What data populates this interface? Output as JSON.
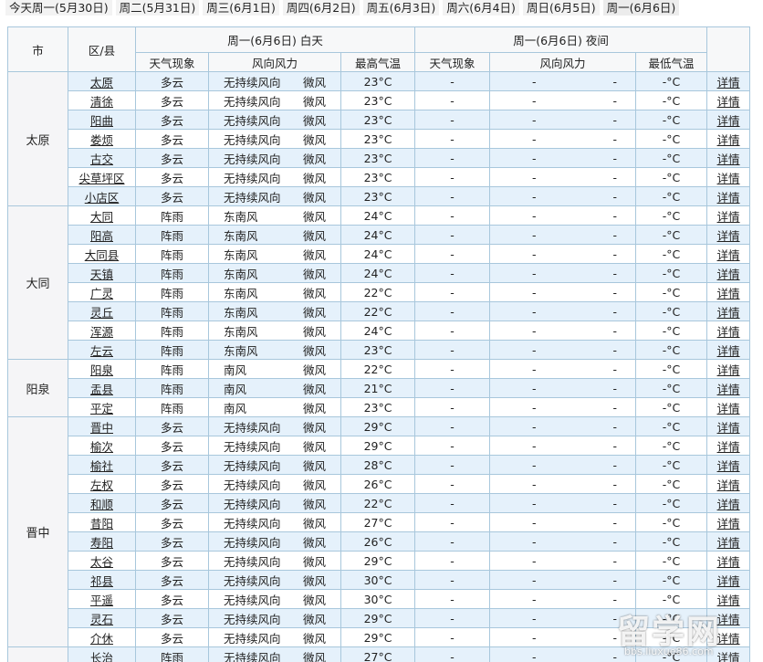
{
  "tabs": [
    "今天周一(5月30日)",
    "周二(5月31日)",
    "周三(6月1日)",
    "周四(6月2日)",
    "周五(6月3日)",
    "周六(6月4日)",
    "周日(6月5日)",
    "周一(6月6日)"
  ],
  "active_tab": 7,
  "header": {
    "city": "市",
    "district": "区/县",
    "day_title": "周一(6月6日) 白天",
    "night_title": "周一(6月6日) 夜间",
    "weather": "天气现象",
    "wind": "风向风力",
    "high": "最高气温",
    "low": "最低气温"
  },
  "colors": {
    "border": "#a8c7dc",
    "row_alt": "#e5f1fb",
    "city_bg": "#f5f5f7"
  },
  "night": {
    "weather": "-",
    "wind_dir": "-",
    "wind_force": "-",
    "low": "-°C"
  },
  "detail_label": "详情",
  "cities": [
    {
      "name": "太原",
      "rows": [
        {
          "district": "太原",
          "weather": "多云",
          "wind_dir": "无持续风向",
          "wind_force": "微风",
          "high": "23°C"
        },
        {
          "district": "清徐",
          "weather": "多云",
          "wind_dir": "无持续风向",
          "wind_force": "微风",
          "high": "23°C"
        },
        {
          "district": "阳曲",
          "weather": "多云",
          "wind_dir": "无持续风向",
          "wind_force": "微风",
          "high": "23°C"
        },
        {
          "district": "娄烦",
          "weather": "多云",
          "wind_dir": "无持续风向",
          "wind_force": "微风",
          "high": "23°C"
        },
        {
          "district": "古交",
          "weather": "多云",
          "wind_dir": "无持续风向",
          "wind_force": "微风",
          "high": "23°C"
        },
        {
          "district": "尖草坪区",
          "weather": "多云",
          "wind_dir": "无持续风向",
          "wind_force": "微风",
          "high": "23°C"
        },
        {
          "district": "小店区",
          "weather": "多云",
          "wind_dir": "无持续风向",
          "wind_force": "微风",
          "high": "23°C"
        }
      ]
    },
    {
      "name": "大同",
      "rows": [
        {
          "district": "大同",
          "weather": "阵雨",
          "wind_dir": "东南风",
          "wind_force": "微风",
          "high": "24°C"
        },
        {
          "district": "阳高",
          "weather": "阵雨",
          "wind_dir": "东南风",
          "wind_force": "微风",
          "high": "24°C"
        },
        {
          "district": "大同县",
          "weather": "阵雨",
          "wind_dir": "东南风",
          "wind_force": "微风",
          "high": "24°C"
        },
        {
          "district": "天镇",
          "weather": "阵雨",
          "wind_dir": "东南风",
          "wind_force": "微风",
          "high": "24°C"
        },
        {
          "district": "广灵",
          "weather": "阵雨",
          "wind_dir": "东南风",
          "wind_force": "微风",
          "high": "22°C"
        },
        {
          "district": "灵丘",
          "weather": "阵雨",
          "wind_dir": "东南风",
          "wind_force": "微风",
          "high": "22°C"
        },
        {
          "district": "浑源",
          "weather": "阵雨",
          "wind_dir": "东南风",
          "wind_force": "微风",
          "high": "24°C"
        },
        {
          "district": "左云",
          "weather": "阵雨",
          "wind_dir": "东南风",
          "wind_force": "微风",
          "high": "23°C"
        }
      ]
    },
    {
      "name": "阳泉",
      "rows": [
        {
          "district": "阳泉",
          "weather": "阵雨",
          "wind_dir": "南风",
          "wind_force": "微风",
          "high": "22°C"
        },
        {
          "district": "盂县",
          "weather": "阵雨",
          "wind_dir": "南风",
          "wind_force": "微风",
          "high": "21°C"
        },
        {
          "district": "平定",
          "weather": "阵雨",
          "wind_dir": "南风",
          "wind_force": "微风",
          "high": "23°C"
        }
      ]
    },
    {
      "name": "晋中",
      "rows": [
        {
          "district": "晋中",
          "weather": "多云",
          "wind_dir": "无持续风向",
          "wind_force": "微风",
          "high": "29°C"
        },
        {
          "district": "榆次",
          "weather": "多云",
          "wind_dir": "无持续风向",
          "wind_force": "微风",
          "high": "29°C"
        },
        {
          "district": "榆社",
          "weather": "多云",
          "wind_dir": "无持续风向",
          "wind_force": "微风",
          "high": "28°C"
        },
        {
          "district": "左权",
          "weather": "多云",
          "wind_dir": "无持续风向",
          "wind_force": "微风",
          "high": "26°C"
        },
        {
          "district": "和顺",
          "weather": "多云",
          "wind_dir": "无持续风向",
          "wind_force": "微风",
          "high": "22°C"
        },
        {
          "district": "昔阳",
          "weather": "多云",
          "wind_dir": "无持续风向",
          "wind_force": "微风",
          "high": "27°C"
        },
        {
          "district": "寿阳",
          "weather": "多云",
          "wind_dir": "无持续风向",
          "wind_force": "微风",
          "high": "26°C"
        },
        {
          "district": "太谷",
          "weather": "多云",
          "wind_dir": "无持续风向",
          "wind_force": "微风",
          "high": "29°C"
        },
        {
          "district": "祁县",
          "weather": "多云",
          "wind_dir": "无持续风向",
          "wind_force": "微风",
          "high": "30°C"
        },
        {
          "district": "平遥",
          "weather": "多云",
          "wind_dir": "无持续风向",
          "wind_force": "微风",
          "high": "30°C"
        },
        {
          "district": "灵石",
          "weather": "多云",
          "wind_dir": "无持续风向",
          "wind_force": "微风",
          "high": "29°C"
        },
        {
          "district": "介休",
          "weather": "多云",
          "wind_dir": "无持续风向",
          "wind_force": "微风",
          "high": "29°C"
        }
      ]
    },
    {
      "name": "",
      "rows": [
        {
          "district": "长治",
          "weather": "阵雨",
          "wind_dir": "无持续风向",
          "wind_force": "微风",
          "high": "27°C"
        }
      ]
    }
  ],
  "watermark": {
    "text": "留学网",
    "url": "bbs.liuxue86.com"
  }
}
